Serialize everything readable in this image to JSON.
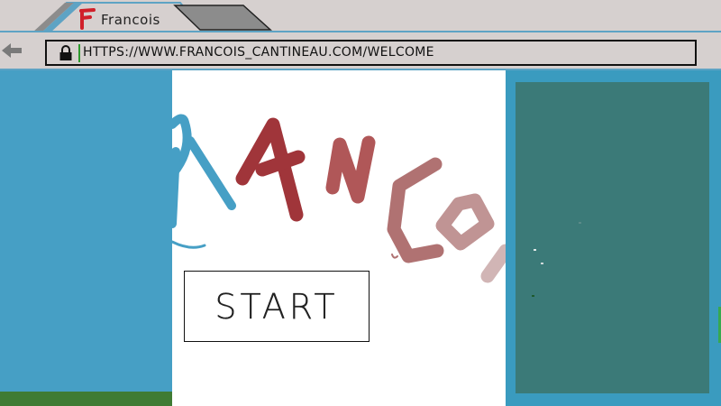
{
  "tab": {
    "active_title": "Francois",
    "favicon_letter": "F",
    "favicon_color": "#d0202a"
  },
  "address_bar": {
    "url": "HTTPS://WWW.FRANCOIS_CANTINEAU.COM/WELCOME"
  },
  "main": {
    "logo_text": "FRANCOIS",
    "start_label": "START"
  },
  "colors": {
    "chrome": "#d6d0cf",
    "accent": "#5ea3c4",
    "left_bg": "#469fc5",
    "right_bg": "#3a9bbf",
    "right_panel": "#3b7a78",
    "grass": "#3f7b34"
  }
}
